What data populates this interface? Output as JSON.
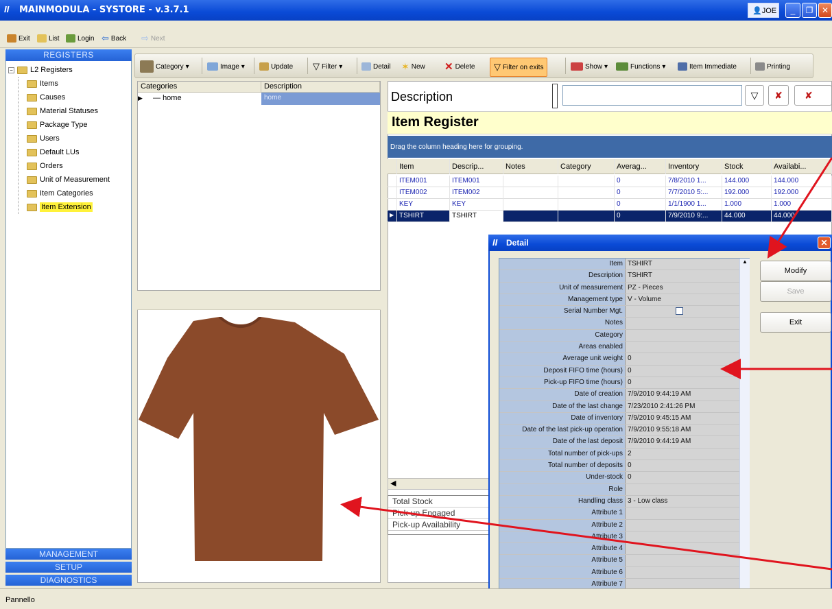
{
  "window": {
    "title": "MAINMODULA - SYSTORE - v.3.7.1",
    "user": "JOE",
    "logo_mark": "II"
  },
  "toolbar1": [
    "Exit",
    "List",
    "Login",
    "Back",
    "Next"
  ],
  "left": {
    "header": "REGISTERS",
    "root": "L2 Registers",
    "items": [
      "Items",
      "Causes",
      "Material Statuses",
      "Package Type",
      "Users",
      "Default LUs",
      "Orders",
      "Unit of Measurement",
      "Item Categories",
      "Item Extension"
    ],
    "selected": "Item Extension",
    "nav": [
      "MANAGEMENT",
      "SETUP",
      "DIAGNOSTICS"
    ]
  },
  "toolbar2": [
    "Category",
    "Image",
    "Update",
    "Filter",
    "Detail",
    "New",
    "Delete",
    "Filter on exits",
    "Show",
    "Functions",
    "Item Immediate",
    "Printing"
  ],
  "categories": {
    "headers": [
      "Categories",
      "Description"
    ],
    "rows": [
      {
        "name": "home",
        "desc": "home"
      }
    ]
  },
  "description_label": "Description",
  "item_register": {
    "title": "Item Register",
    "grouping": "Drag the column heading here for grouping.",
    "headers": [
      "Item",
      "Descrip...",
      "Notes",
      "Category",
      "Averag...",
      "Inventory",
      "Stock",
      "Availabi..."
    ],
    "rows": [
      [
        "ITEM001",
        "ITEM001",
        "",
        "",
        "0",
        "7/8/2010 1...",
        "144.000",
        "144.000"
      ],
      [
        "ITEM002",
        "ITEM002",
        "",
        "",
        "0",
        "7/7/2010 5:...",
        "192.000",
        "192.000"
      ],
      [
        "KEY",
        "KEY",
        "",
        "",
        "0",
        "1/1/1900 1...",
        "1.000",
        "1.000"
      ],
      [
        "TSHIRT",
        "TSHIRT",
        "",
        "",
        "0",
        "7/9/2010 9:...",
        "44.000",
        "44.000"
      ]
    ]
  },
  "totals": [
    "Total Stock",
    "Pick-up Engaged",
    "Pick-up Availability"
  ],
  "detail": {
    "title": "Detail",
    "fields": [
      [
        "Item",
        "TSHIRT"
      ],
      [
        "Description",
        "TSHIRT"
      ],
      [
        "Unit of measurement",
        "PZ - Pieces"
      ],
      [
        "Management type",
        "V - Volume"
      ],
      [
        "Serial Number Mgt.",
        ""
      ],
      [
        "Notes",
        ""
      ],
      [
        "Category",
        ""
      ],
      [
        "Areas enabled",
        ""
      ],
      [
        "Average unit weight",
        "0"
      ],
      [
        "Deposit FIFO time (hours)",
        "0"
      ],
      [
        "Pick-up FIFO time (hours)",
        "0"
      ],
      [
        "Date of creation",
        "7/9/2010 9:44:19 AM"
      ],
      [
        "Date of the last change",
        "7/23/2010 2:41:26 PM"
      ],
      [
        "Date of inventory",
        "7/9/2010 9:45:15 AM"
      ],
      [
        "Date of the last pick-up operation",
        "7/9/2010 9:55:18 AM"
      ],
      [
        "Date of the last deposit",
        "7/9/2010 9:44:19 AM"
      ],
      [
        "Total number of pick-ups",
        "2"
      ],
      [
        "Total number of deposits",
        "0"
      ],
      [
        "Under-stock",
        "0"
      ],
      [
        "Role",
        ""
      ],
      [
        "Handling class",
        "3 - Low class"
      ],
      [
        "Attribute 1",
        ""
      ],
      [
        "Attribute 2",
        ""
      ],
      [
        "Attribute 3",
        ""
      ],
      [
        "Attribute 4",
        ""
      ],
      [
        "Attribute 5",
        ""
      ],
      [
        "Attribute 6",
        ""
      ],
      [
        "Attribute 7",
        ""
      ]
    ],
    "buttons": [
      "Modify",
      "Save",
      "Exit"
    ]
  },
  "status": "Pannello",
  "colors": {
    "title": "#0a4ad6",
    "selected_row": "#0a246a",
    "highlight": "#fff23a",
    "shirt": "#8b4a2a",
    "arrow": "#e0141e"
  }
}
